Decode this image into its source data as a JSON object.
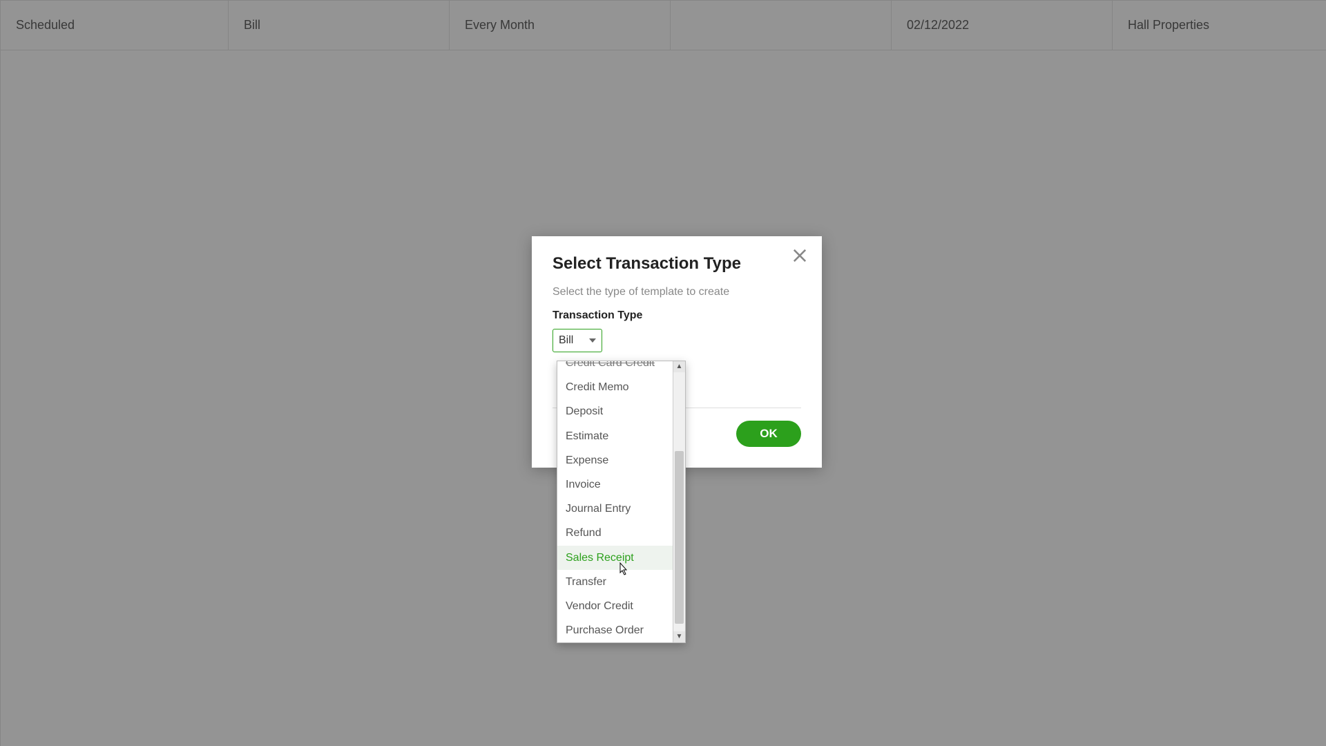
{
  "table": {
    "row": {
      "status": "Scheduled",
      "type": "Bill",
      "interval": "Every Month",
      "prev": "",
      "next": "02/12/2022",
      "payee": "Hall Properties"
    }
  },
  "modal": {
    "title": "Select Transaction Type",
    "subtitle": "Select the type of template to create",
    "field_label": "Transaction Type",
    "selected": "Bill",
    "ok": "OK"
  },
  "dropdown": {
    "items": [
      {
        "label": "Credit Card Credit",
        "cut": true
      },
      {
        "label": "Credit Memo"
      },
      {
        "label": "Deposit"
      },
      {
        "label": "Estimate"
      },
      {
        "label": "Expense"
      },
      {
        "label": "Invoice"
      },
      {
        "label": "Journal Entry"
      },
      {
        "label": "Refund"
      },
      {
        "label": "Sales Receipt",
        "hover": true
      },
      {
        "label": "Transfer"
      },
      {
        "label": "Vendor Credit"
      },
      {
        "label": "Purchase Order"
      }
    ]
  },
  "colors": {
    "accent": "#2ca01c"
  }
}
